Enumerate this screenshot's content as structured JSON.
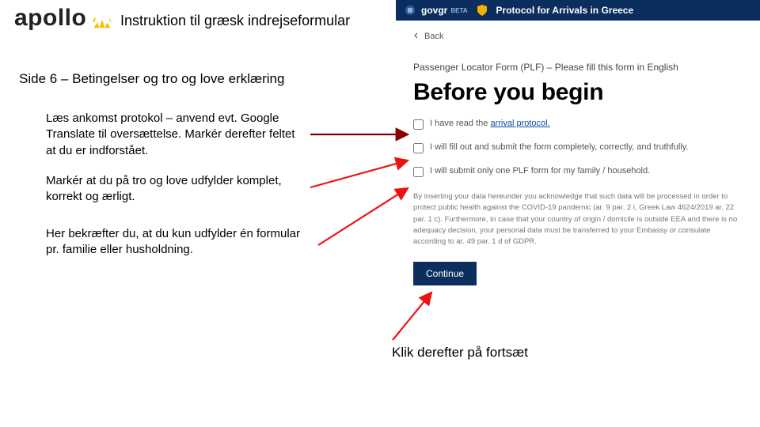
{
  "left": {
    "logo_text": "apollo",
    "title": "Instruktion til græsk indrejseformular",
    "subtitle": "Side 6 – Betingelser og tro og love erklæring",
    "p1": "Læs ankomst protokol – anvend evt. Google Translate til oversættelse. Markér derefter feltet at du er indforstået.",
    "p2": "Markér at du på tro og love udfylder komplet, korrekt og ærligt.",
    "p3": "Her bekræfter du, at du kun udfylder én formular pr. familie eller husholdning.",
    "footer_note": "Klik derefter på fortsæt"
  },
  "right": {
    "govgr_label": "govgr",
    "govgr_beta": "BETA",
    "protocol_title": "Protocol for Arrivals in Greece",
    "back_label": "Back",
    "plf_title": "Passenger Locator Form (PLF) – Please fill this form in English",
    "before_heading": "Before you begin",
    "check1_prefix": "I have read the ",
    "check1_link": "arrival protocol.",
    "check2": "I will fill out and submit the form completely, correctly, and truthfully.",
    "check3": "I will submit only one PLF form for my family / household.",
    "legal": "By inserting your data hereunder you acknowledge that such data will be processed in order to protect public health against the COVID-19 pandemic (ar. 9 par. 2 i, Greek Law 4624/2019 ar. 22 par. 1 c). Furthermore, in case that your country of origin / domicile is outside EEA and there is no adequacy decision, your personal data must be transferred to your Embassy or consulate according to ar. 49 par. 1 d of GDPR.",
    "continue_label": "Continue"
  },
  "colors": {
    "gov_blue": "#0b2e5e",
    "apollo_yellow": "#f2c200",
    "arrow_red": "#e11",
    "arrow_dark": "#8a0000"
  }
}
